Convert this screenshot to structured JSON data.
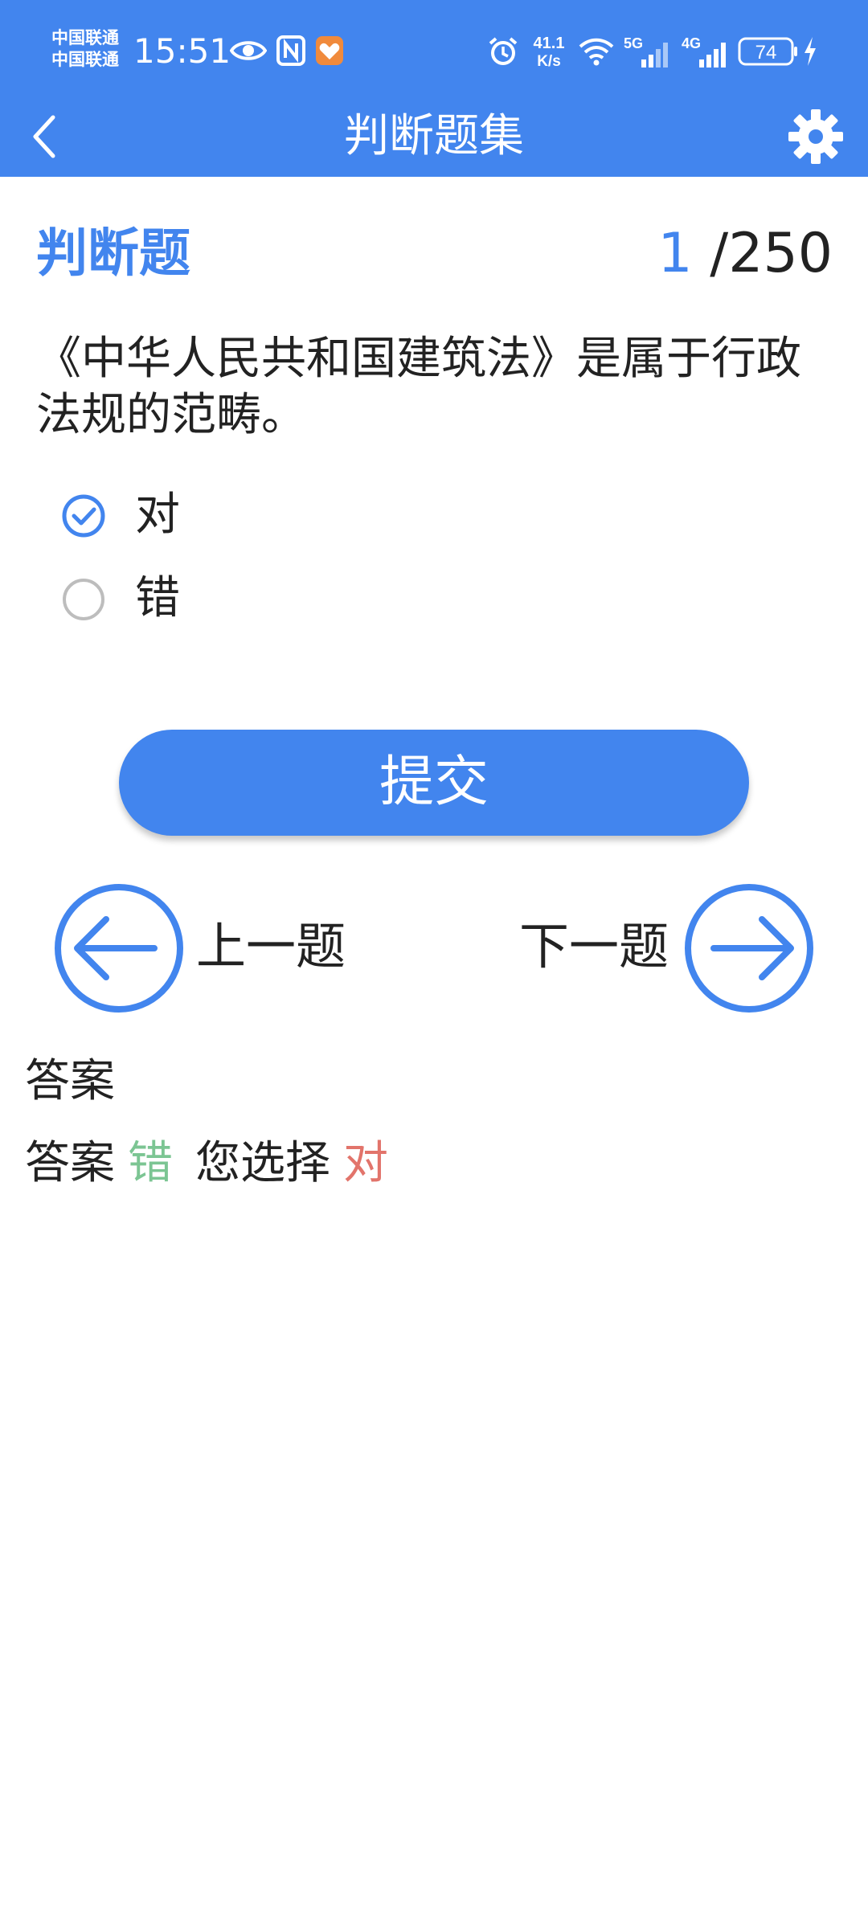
{
  "status_bar": {
    "carrier_1": "中国联通",
    "carrier_2": "中国联通",
    "time": "15:51",
    "net_speed_value": "41.1",
    "net_speed_unit": "K/s",
    "signal_1_label": "5G",
    "signal_2_label": "4G",
    "battery": "74",
    "icons": [
      "eye-icon",
      "nfc-icon",
      "app-heart-icon",
      "alarm-icon",
      "wifi-icon",
      "signal-icon",
      "battery-icon",
      "charging-bolt-icon"
    ]
  },
  "header": {
    "title": "判断题集",
    "back_icon": "chevron-left-icon",
    "settings_icon": "gear-icon"
  },
  "question": {
    "section_title": "判断题",
    "current": "1",
    "total": "/250",
    "text": "《中华人民共和国建筑法》是属于行政法规的范畴。",
    "options": [
      {
        "label": "对",
        "selected": true
      },
      {
        "label": "错",
        "selected": false
      }
    ]
  },
  "actions": {
    "submit_label": "提交",
    "prev_label": "上一题",
    "next_label": "下一题"
  },
  "answer": {
    "heading": "答案",
    "answer_prefix": "答案",
    "correct_value": "错",
    "chosen_prefix": "您选择",
    "chosen_value": "对"
  },
  "colors": {
    "primary": "#4285EE",
    "correct": "#7CC593",
    "wrong": "#E2746B",
    "radio_unselected": "#BDBDBD"
  }
}
